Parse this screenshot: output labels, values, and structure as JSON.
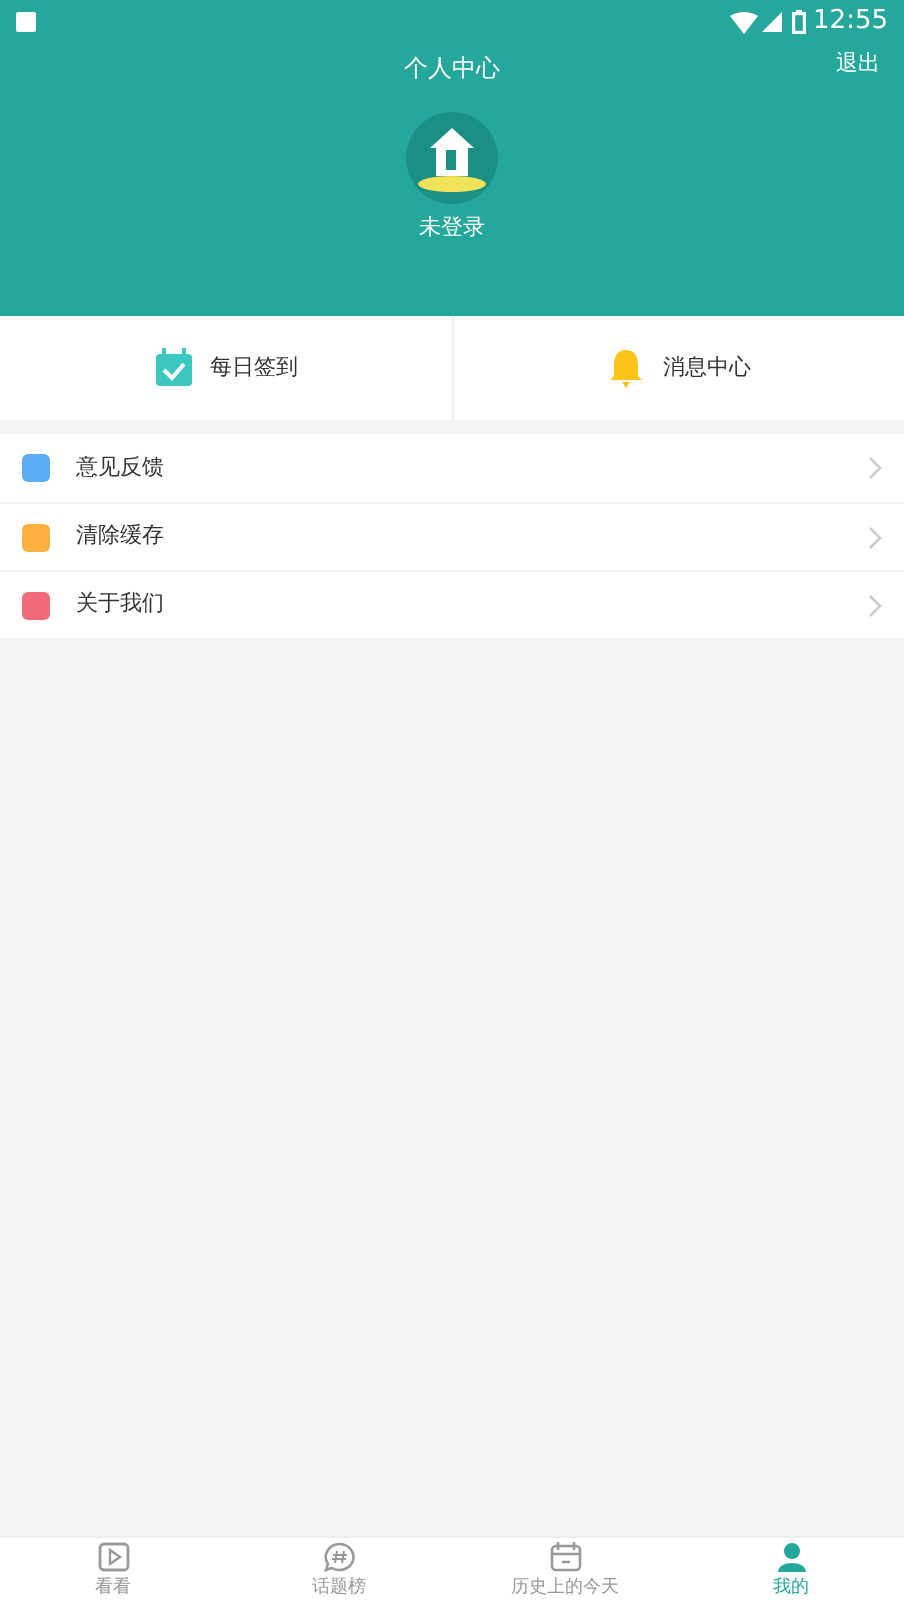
{
  "status_bar": {
    "time": "12:55"
  },
  "header": {
    "title": "个人中心",
    "logout": "退出",
    "user": "未登录"
  },
  "quick_actions": [
    {
      "label": "每日签到"
    },
    {
      "label": "消息中心"
    }
  ],
  "menu": [
    {
      "label": "意见反馈",
      "color": "#5aaef5"
    },
    {
      "label": "清除缓存",
      "color": "#fbb040"
    },
    {
      "label": "关于我们",
      "color": "#f06a7a"
    }
  ],
  "tabs": [
    {
      "label": "看看",
      "selected": false
    },
    {
      "label": "话题榜",
      "selected": false
    },
    {
      "label": "历史上的今天",
      "selected": false
    },
    {
      "label": "我的",
      "selected": true
    }
  ]
}
